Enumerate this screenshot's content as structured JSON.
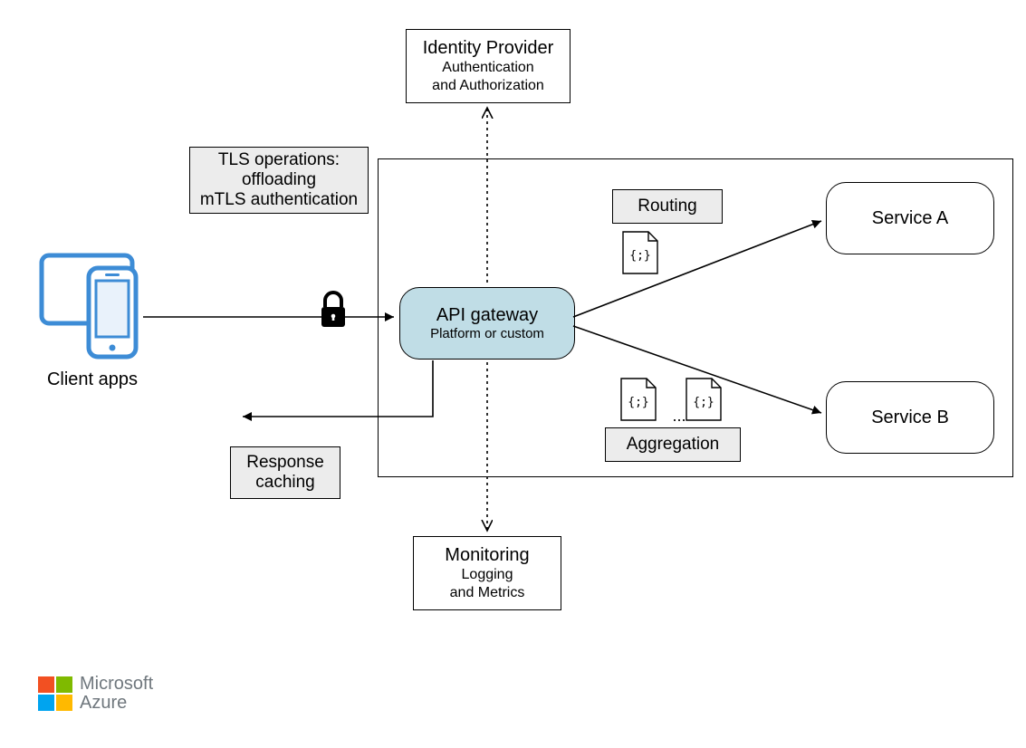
{
  "identity": {
    "title": "Identity Provider",
    "line1": "Authentication",
    "line2": "and Authorization"
  },
  "tls": {
    "title": "TLS operations:",
    "line1": "offloading",
    "line2": "mTLS authentication"
  },
  "client": {
    "label": "Client apps"
  },
  "api": {
    "title": "API gateway",
    "sub": "Platform or custom"
  },
  "routing": {
    "label": "Routing"
  },
  "aggregation": {
    "label": "Aggregation",
    "dots": "..."
  },
  "serviceA": {
    "label": "Service A"
  },
  "serviceB": {
    "label": "Service B"
  },
  "response": {
    "title": "Response",
    "line1": "caching"
  },
  "monitoring": {
    "title": "Monitoring",
    "line1": "Logging",
    "line2": "and Metrics"
  },
  "brand": {
    "line1": "Microsoft",
    "line2": "Azure"
  },
  "colors": {
    "api_fill": "#c0dde6",
    "grey": "#ececec",
    "azure_blue": "#3d8cd6"
  }
}
